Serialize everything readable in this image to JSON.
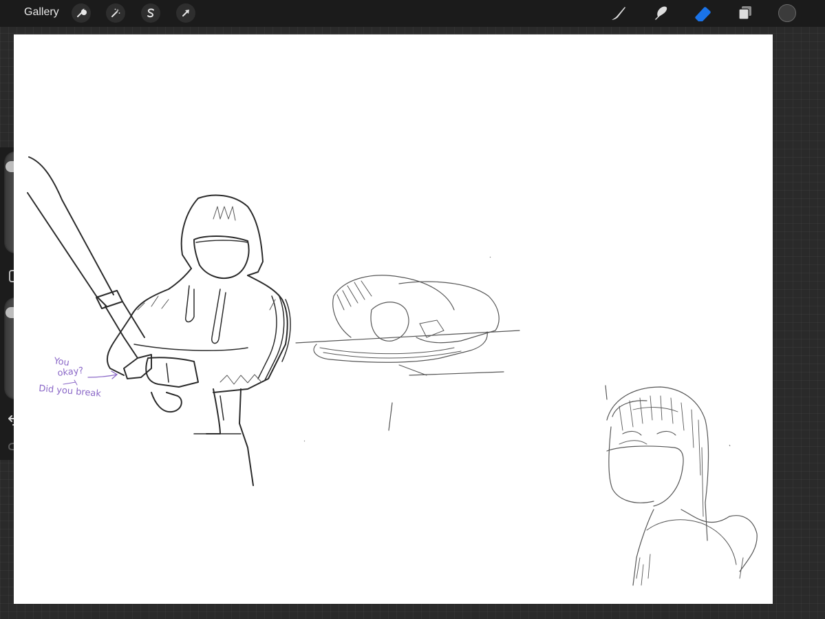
{
  "toolbar": {
    "gallery_label": "Gallery",
    "left_icons": [
      "wrench-icon",
      "magic-wand-icon",
      "selection-s-icon",
      "arrow-cursor-icon"
    ],
    "right_icons": [
      "brush-icon",
      "smudge-icon",
      "eraser-icon",
      "layers-icon"
    ],
    "active_tool": "eraser",
    "active_color": "#1a73e8",
    "current_color": "#3b3b3b"
  },
  "canvas": {
    "background": "#ffffff",
    "handwritten_note": {
      "line1": "You",
      "line2": "okay?",
      "line3": "Did you break",
      "color": "#8a67c7"
    }
  },
  "sidebar": {
    "brush_size_level": 0.92,
    "opacity_level": 0.92,
    "modify_button": "square-icon",
    "undo": "undo-icon",
    "redo": "redo-icon"
  }
}
